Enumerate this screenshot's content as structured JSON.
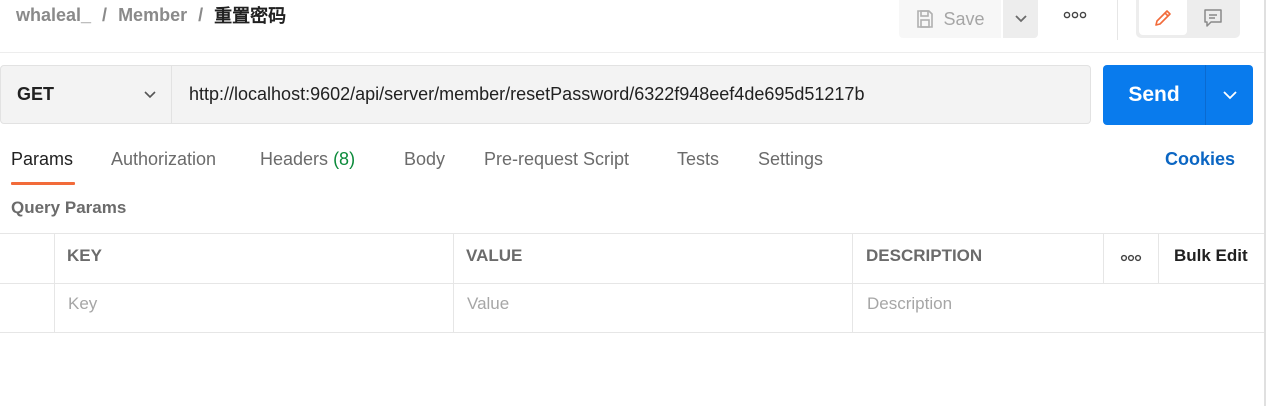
{
  "breadcrumb": {
    "workspace": "whaleal_",
    "collection": "Member",
    "request": "重置密码",
    "separator": "/"
  },
  "toolbar": {
    "save_label": "Save",
    "save_icon": "save-icon",
    "more_icon": "more-horizontal-icon",
    "edit_icon": "pencil-icon",
    "comment_icon": "comment-icon"
  },
  "request": {
    "method": "GET",
    "url": "http://localhost:9602/api/server/member/resetPassword/6322f948eef4de695d51217b",
    "send_label": "Send"
  },
  "tabs": [
    {
      "label": "Params",
      "active": true
    },
    {
      "label": "Authorization"
    },
    {
      "label": "Headers",
      "count": "(8)"
    },
    {
      "label": "Body"
    },
    {
      "label": "Pre-request Script"
    },
    {
      "label": "Tests"
    },
    {
      "label": "Settings"
    }
  ],
  "cookies_label": "Cookies",
  "query_params": {
    "title": "Query Params",
    "columns": {
      "key": "KEY",
      "value": "VALUE",
      "description": "DESCRIPTION"
    },
    "bulk_edit_label": "Bulk Edit",
    "placeholders": {
      "key": "Key",
      "value": "Value",
      "description": "Description"
    }
  },
  "colors": {
    "accent_orange": "#f26b3a",
    "send_blue": "#097bed",
    "link_blue": "#0b66c3",
    "count_green": "#0b8a3a"
  }
}
